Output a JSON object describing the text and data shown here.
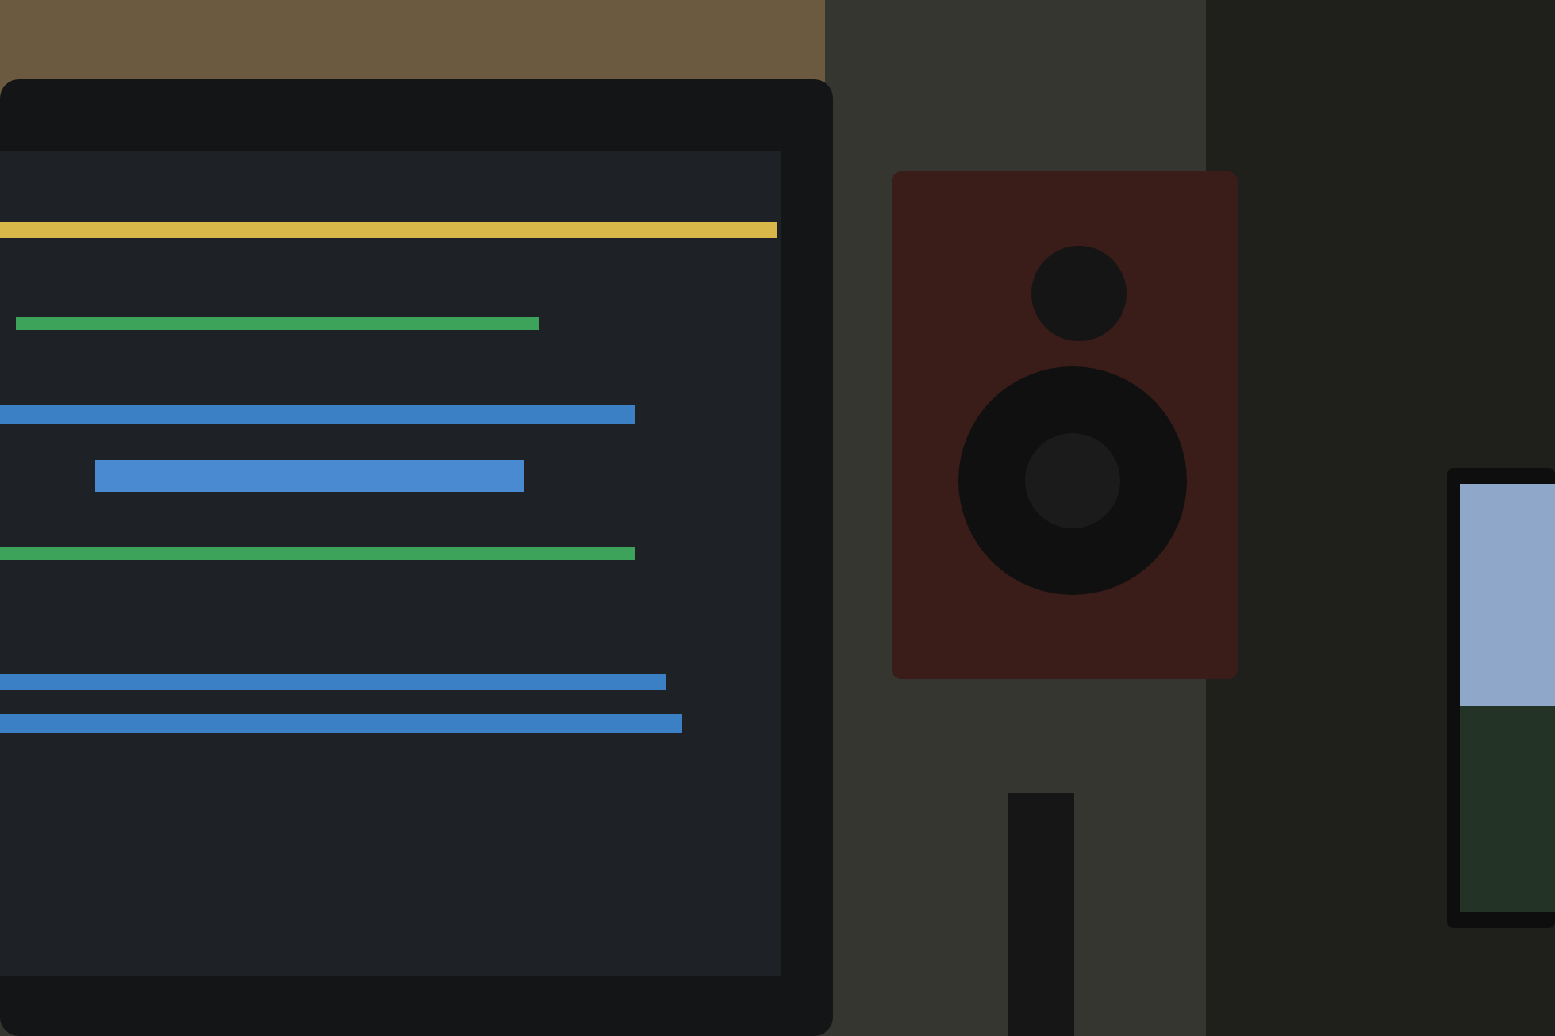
{
  "scene": {
    "kind": "photo"
  }
}
